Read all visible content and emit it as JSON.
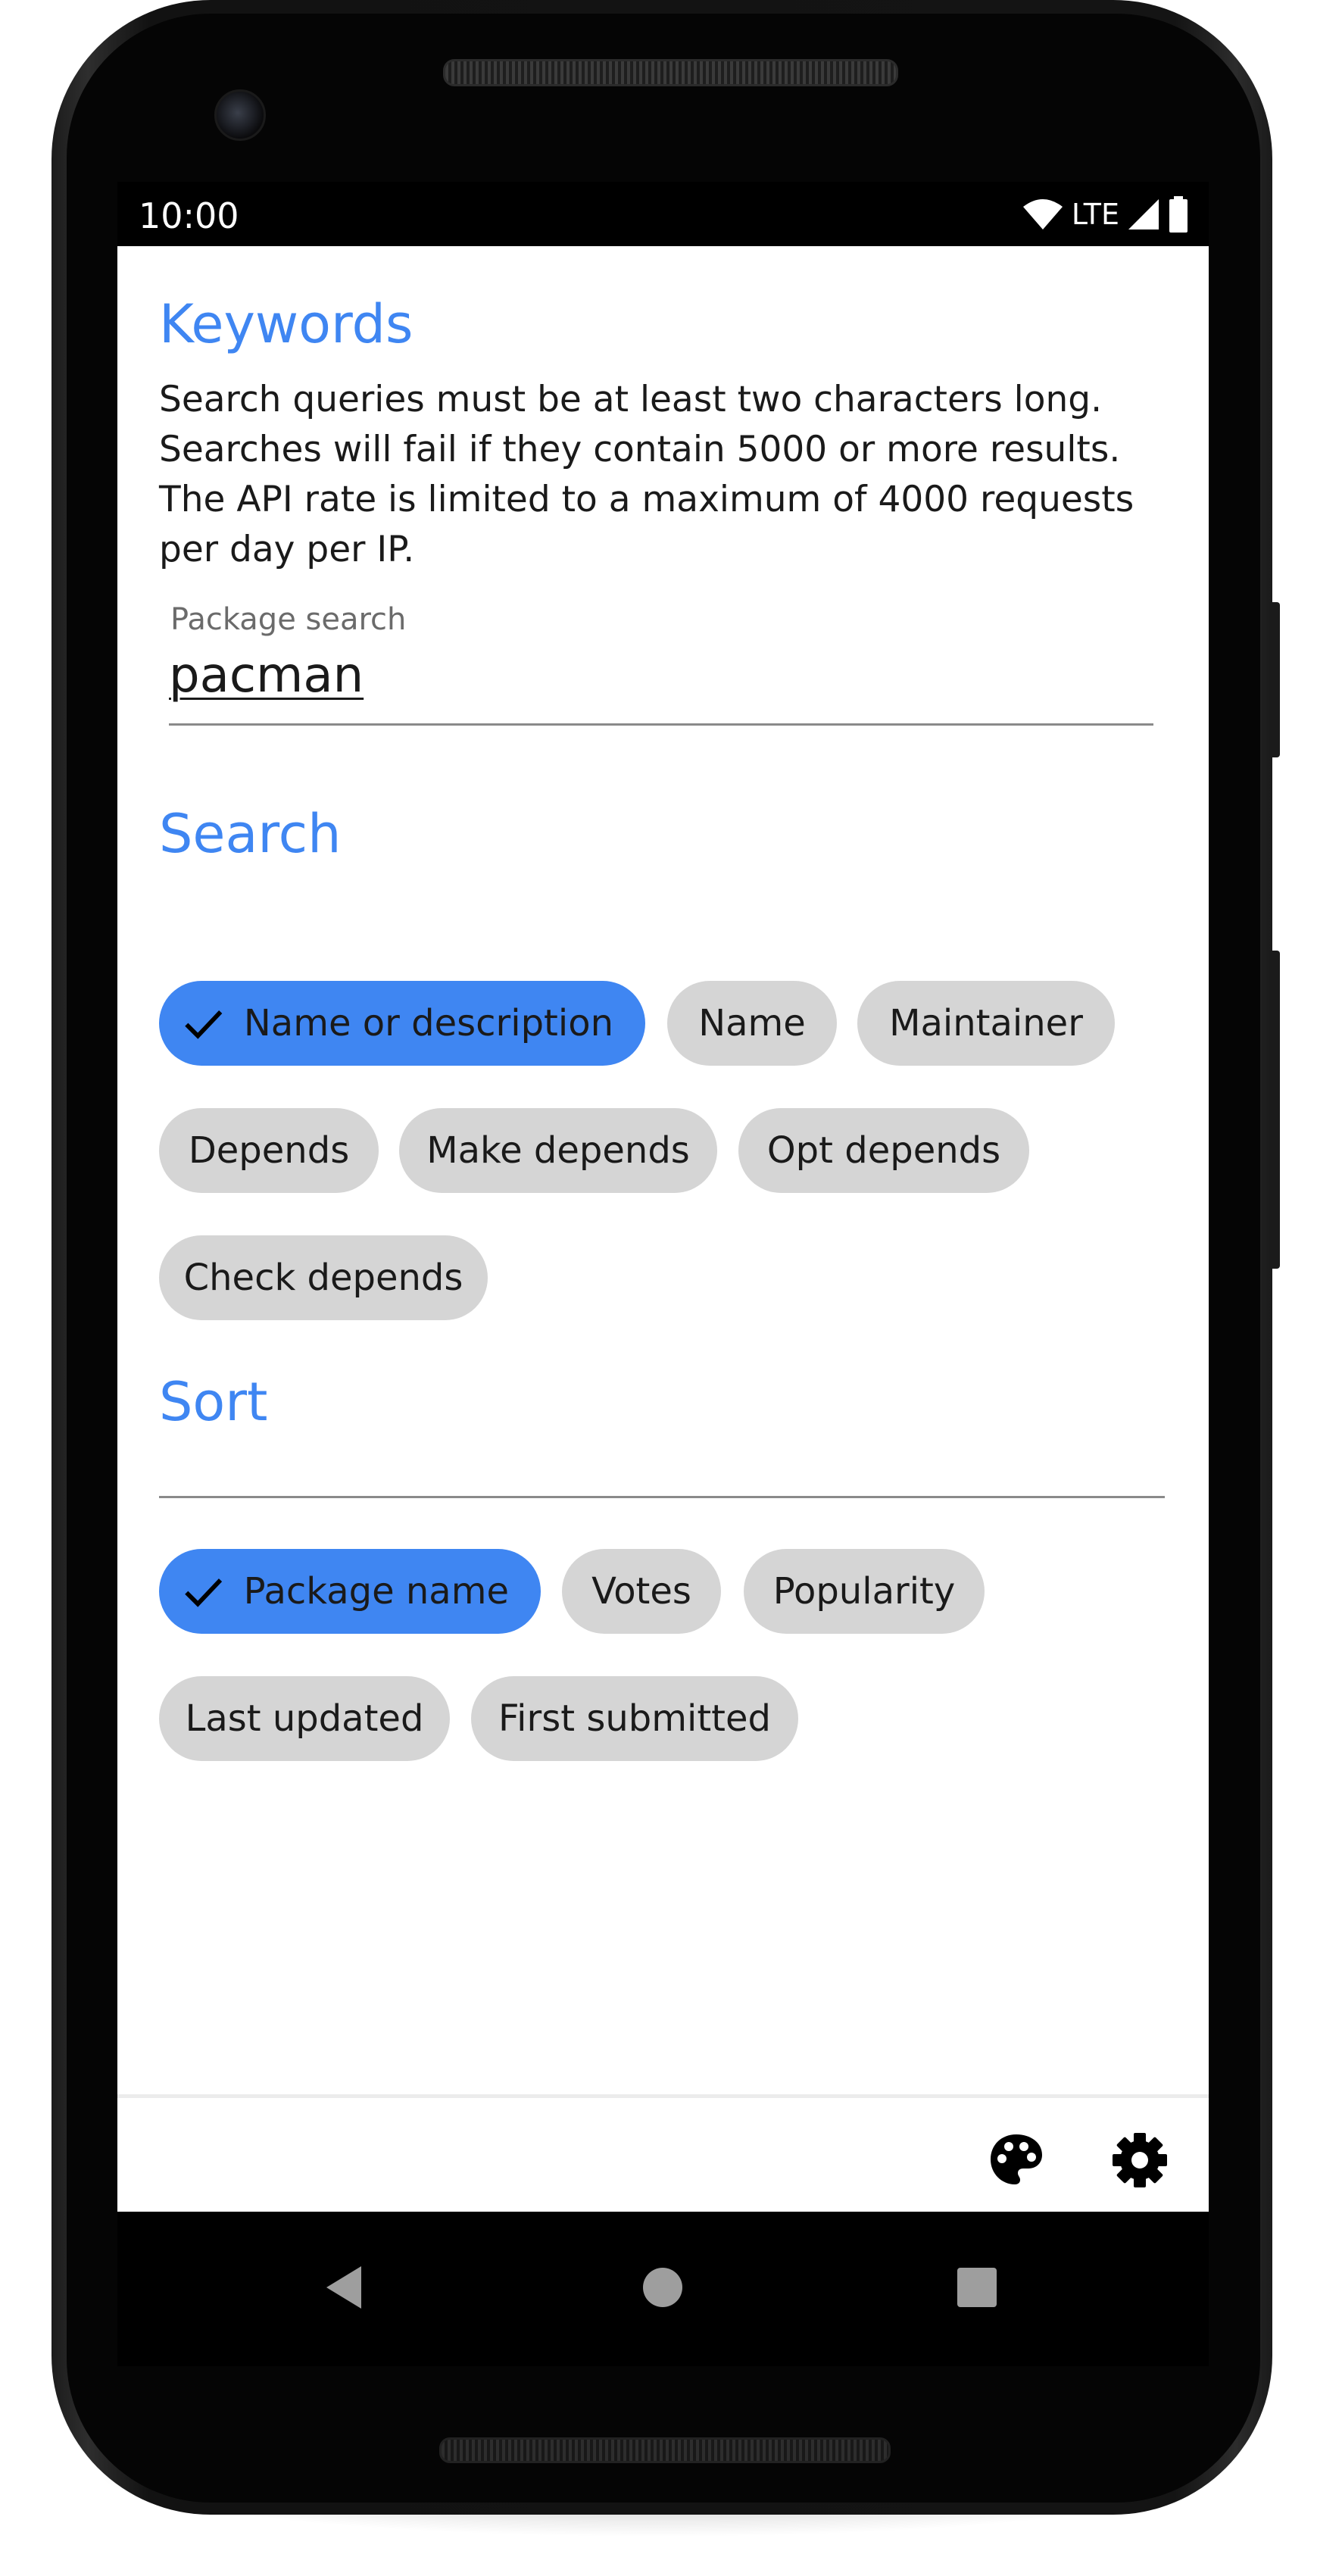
{
  "status_bar": {
    "time": "10:00",
    "network": "LTE",
    "icons": [
      "wifi-icon",
      "signal-icon",
      "battery-icon"
    ]
  },
  "keywords": {
    "title": "Keywords",
    "description_lines": [
      "Search queries must be at least two characters long.",
      "Searches will fail if they contain 5000 or more results.",
      "The API rate is limited to a maximum of 4000 requests",
      "per day per IP."
    ]
  },
  "package_search": {
    "label": "Package search",
    "value": "pacman"
  },
  "search": {
    "title": "Search",
    "options": [
      {
        "label": "Name or description",
        "selected": true
      },
      {
        "label": "Name",
        "selected": false
      },
      {
        "label": "Maintainer",
        "selected": false
      },
      {
        "label": "Depends",
        "selected": false
      },
      {
        "label": "Make depends",
        "selected": false
      },
      {
        "label": "Opt depends",
        "selected": false
      },
      {
        "label": "Check depends",
        "selected": false
      }
    ]
  },
  "sort": {
    "title": "Sort",
    "options": [
      {
        "label": "Package name",
        "selected": true
      },
      {
        "label": "Votes",
        "selected": false
      },
      {
        "label": "Popularity",
        "selected": false
      },
      {
        "label": "Last updated",
        "selected": false
      },
      {
        "label": "First submitted",
        "selected": false
      }
    ]
  },
  "bottom_bar": {
    "icons": [
      "palette-icon",
      "settings-icon"
    ]
  },
  "nav_bar": {
    "icons": [
      "back-icon",
      "home-icon",
      "recents-icon"
    ]
  },
  "colors": {
    "accent": "#3f86f2",
    "chip_background": "#d5d5d5",
    "text": "#1a1a1a"
  }
}
